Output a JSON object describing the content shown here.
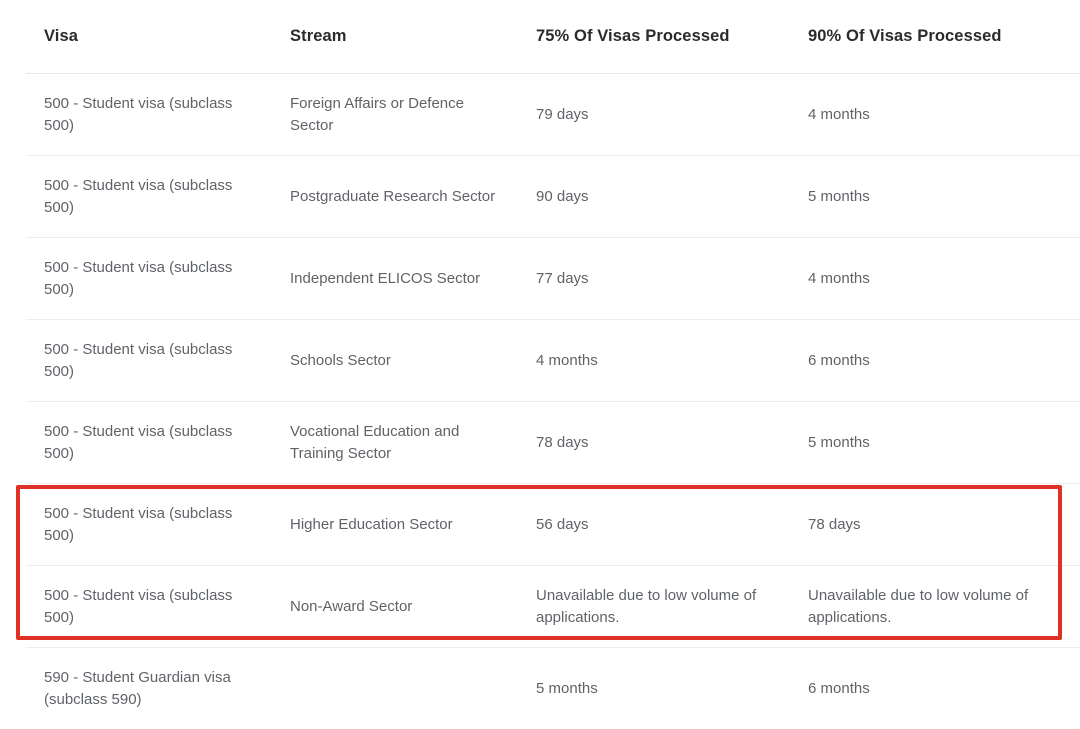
{
  "table": {
    "columns": [
      {
        "key": "visa",
        "label": "Visa"
      },
      {
        "key": "stream",
        "label": "Stream"
      },
      {
        "key": "p75",
        "label": "75% Of Visas Processed"
      },
      {
        "key": "p90",
        "label": "90% Of Visas Processed"
      }
    ],
    "rows": [
      {
        "visa": "500 - Student visa (subclass 500)",
        "stream": "Foreign Affairs or Defence Sector",
        "p75": "79 days",
        "p90": "4 months",
        "highlighted": false
      },
      {
        "visa": "500 - Student visa (subclass 500)",
        "stream": "Postgraduate Research Sector",
        "p75": "90 days",
        "p90": "5 months",
        "highlighted": false
      },
      {
        "visa": "500 - Student visa (subclass 500)",
        "stream": "Independent ELICOS Sector",
        "p75": "77 days",
        "p90": "4 months",
        "highlighted": false
      },
      {
        "visa": "500 - Student visa (subclass 500)",
        "stream": "Schools Sector",
        "p75": "4 months",
        "p90": "6 months",
        "highlighted": false
      },
      {
        "visa": "500 - Student visa (subclass 500)",
        "stream": "Vocational Education and Training Sector",
        "p75": "78 days",
        "p90": "5 months",
        "highlighted": false
      },
      {
        "visa": "500 - Student visa (subclass 500)",
        "stream": "Higher Education Sector",
        "p75": "56 days",
        "p90": "78 days",
        "highlighted": true
      },
      {
        "visa": "500 - Student visa (subclass 500)",
        "stream": "Non-Award Sector",
        "p75": "Unavailable due to low volume of applications.",
        "p90": "Unavailable due to low volume of applications.",
        "highlighted": true
      },
      {
        "visa": "590 - Student Guardian visa (subclass 590)",
        "stream": "",
        "p75": "5 months",
        "p90": "6 months",
        "highlighted": false
      }
    ]
  },
  "annotation": {
    "type": "highlight-rectangle",
    "color": "#e03127",
    "covers_rows": [
      6,
      7
    ]
  },
  "colors": {
    "header_text": "#2b2b2b",
    "body_text": "#5f6368",
    "row_divider": "#ededed",
    "header_divider": "#e8e8e8",
    "background": "#ffffff",
    "highlight": "#e03127"
  }
}
